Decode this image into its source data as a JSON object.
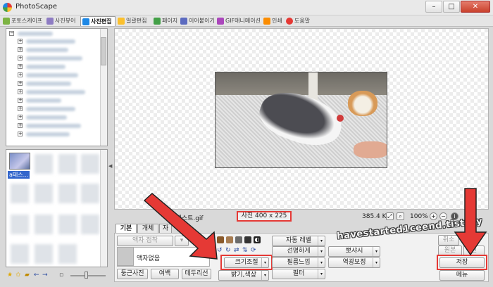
{
  "window": {
    "title": "PhotoScape",
    "minimize": "–",
    "maximize": "□",
    "close": "✕"
  },
  "tabs": [
    {
      "label": "포토스케이프",
      "color": "#7cb342"
    },
    {
      "label": "사진뷰어",
      "color": "#8e7cc3"
    },
    {
      "label": "사진편집",
      "color": "#1e88e5",
      "active": true
    },
    {
      "label": "일괄편집",
      "color": "#fbc02d"
    },
    {
      "label": "페이지",
      "color": "#43a047"
    },
    {
      "label": "이어붙이기",
      "color": "#5c6bc0"
    },
    {
      "label": "GIF애니메이션",
      "color": "#ab47bc"
    },
    {
      "label": "인쇄",
      "color": "#fb8c00"
    },
    {
      "label": "도움말",
      "color": "#e53935"
    }
  ],
  "thumbnail": {
    "label": "a테스..."
  },
  "status": {
    "filename": "a테스트.gif",
    "dimensions": "사진 400 x 225",
    "filesize": "385.4 KB",
    "zoom": "100%"
  },
  "panel": {
    "tabs": [
      "기본",
      "개체",
      "자"
    ],
    "buttons": {
      "frame_fit": "액자 접착",
      "frame_none": "액자없음",
      "rounded": "둥근사진",
      "margin": "여백",
      "border": "테두리선",
      "resize": "크기조절",
      "brightness": "밝기,색상",
      "auto_level": "자동 레벨",
      "sharpen": "선명하게",
      "filmgrain": "필름느낌",
      "filter": "필터",
      "soft": "뽀샤시",
      "backlight": "역광보정",
      "cancel": "취소",
      "original": "원본",
      "restore": "원",
      "save": "저장",
      "menu": "메뉴"
    }
  },
  "watermark": "havestarted1ceend.tistory",
  "accent_color": "#e53935"
}
